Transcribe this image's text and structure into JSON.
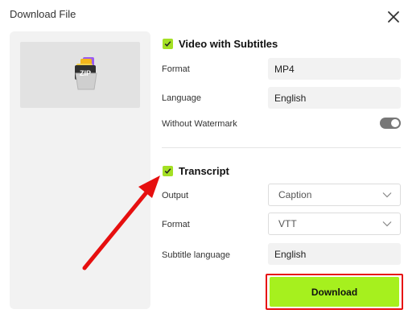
{
  "dialog": {
    "title": "Download File",
    "close_icon": "close-icon"
  },
  "preview": {
    "icon": "zip-folder-icon",
    "zip_label": "ZIP"
  },
  "video": {
    "section_label": "Video with Subtitles",
    "checked": true,
    "format_label": "Format",
    "format_value": "MP4",
    "language_label": "Language",
    "language_value": "English",
    "watermark_label": "Without Watermark",
    "watermark_on": true
  },
  "transcript": {
    "section_label": "Transcript",
    "checked": true,
    "output_label": "Output",
    "output_value": "Caption",
    "format_label": "Format",
    "format_value": "VTT",
    "subtitle_language_label": "Subtitle language",
    "subtitle_language_value": "English"
  },
  "actions": {
    "download_label": "Download"
  },
  "colors": {
    "accent_green": "#a6f01e",
    "checkbox_green": "#a4e024",
    "annotation_red": "#e60f0f"
  }
}
